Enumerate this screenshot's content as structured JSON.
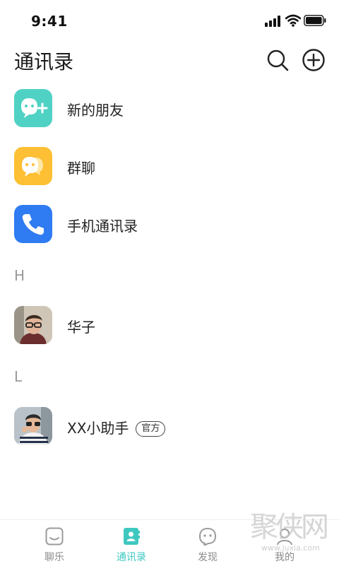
{
  "status_bar": {
    "time": "9:41"
  },
  "header": {
    "title": "通讯录"
  },
  "entries": [
    {
      "label": "新的朋友",
      "icon": "add-friend-icon",
      "color": "#4fd2c4"
    },
    {
      "label": "群聊",
      "icon": "group-chat-icon",
      "color": "#fdbf33"
    },
    {
      "label": "手机通讯录",
      "icon": "phone-icon",
      "color": "#2e7bf2"
    }
  ],
  "sections": [
    {
      "letter": "H",
      "contacts": [
        {
          "name": "华子"
        }
      ]
    },
    {
      "letter": "L",
      "contacts": [
        {
          "name": "XX小助手",
          "badge": "官方"
        }
      ]
    }
  ],
  "tabs": [
    {
      "label": "聊乐",
      "icon": "chat-icon"
    },
    {
      "label": "通讯录",
      "icon": "contacts-icon",
      "active": true
    },
    {
      "label": "发现",
      "icon": "discover-icon"
    },
    {
      "label": "我的",
      "icon": "profile-icon"
    }
  ],
  "watermark": {
    "text": "聚侠网",
    "url": "www.juxia.com"
  },
  "colors": {
    "accent": "#3ec8c0",
    "section_text": "#9a9a9a"
  }
}
